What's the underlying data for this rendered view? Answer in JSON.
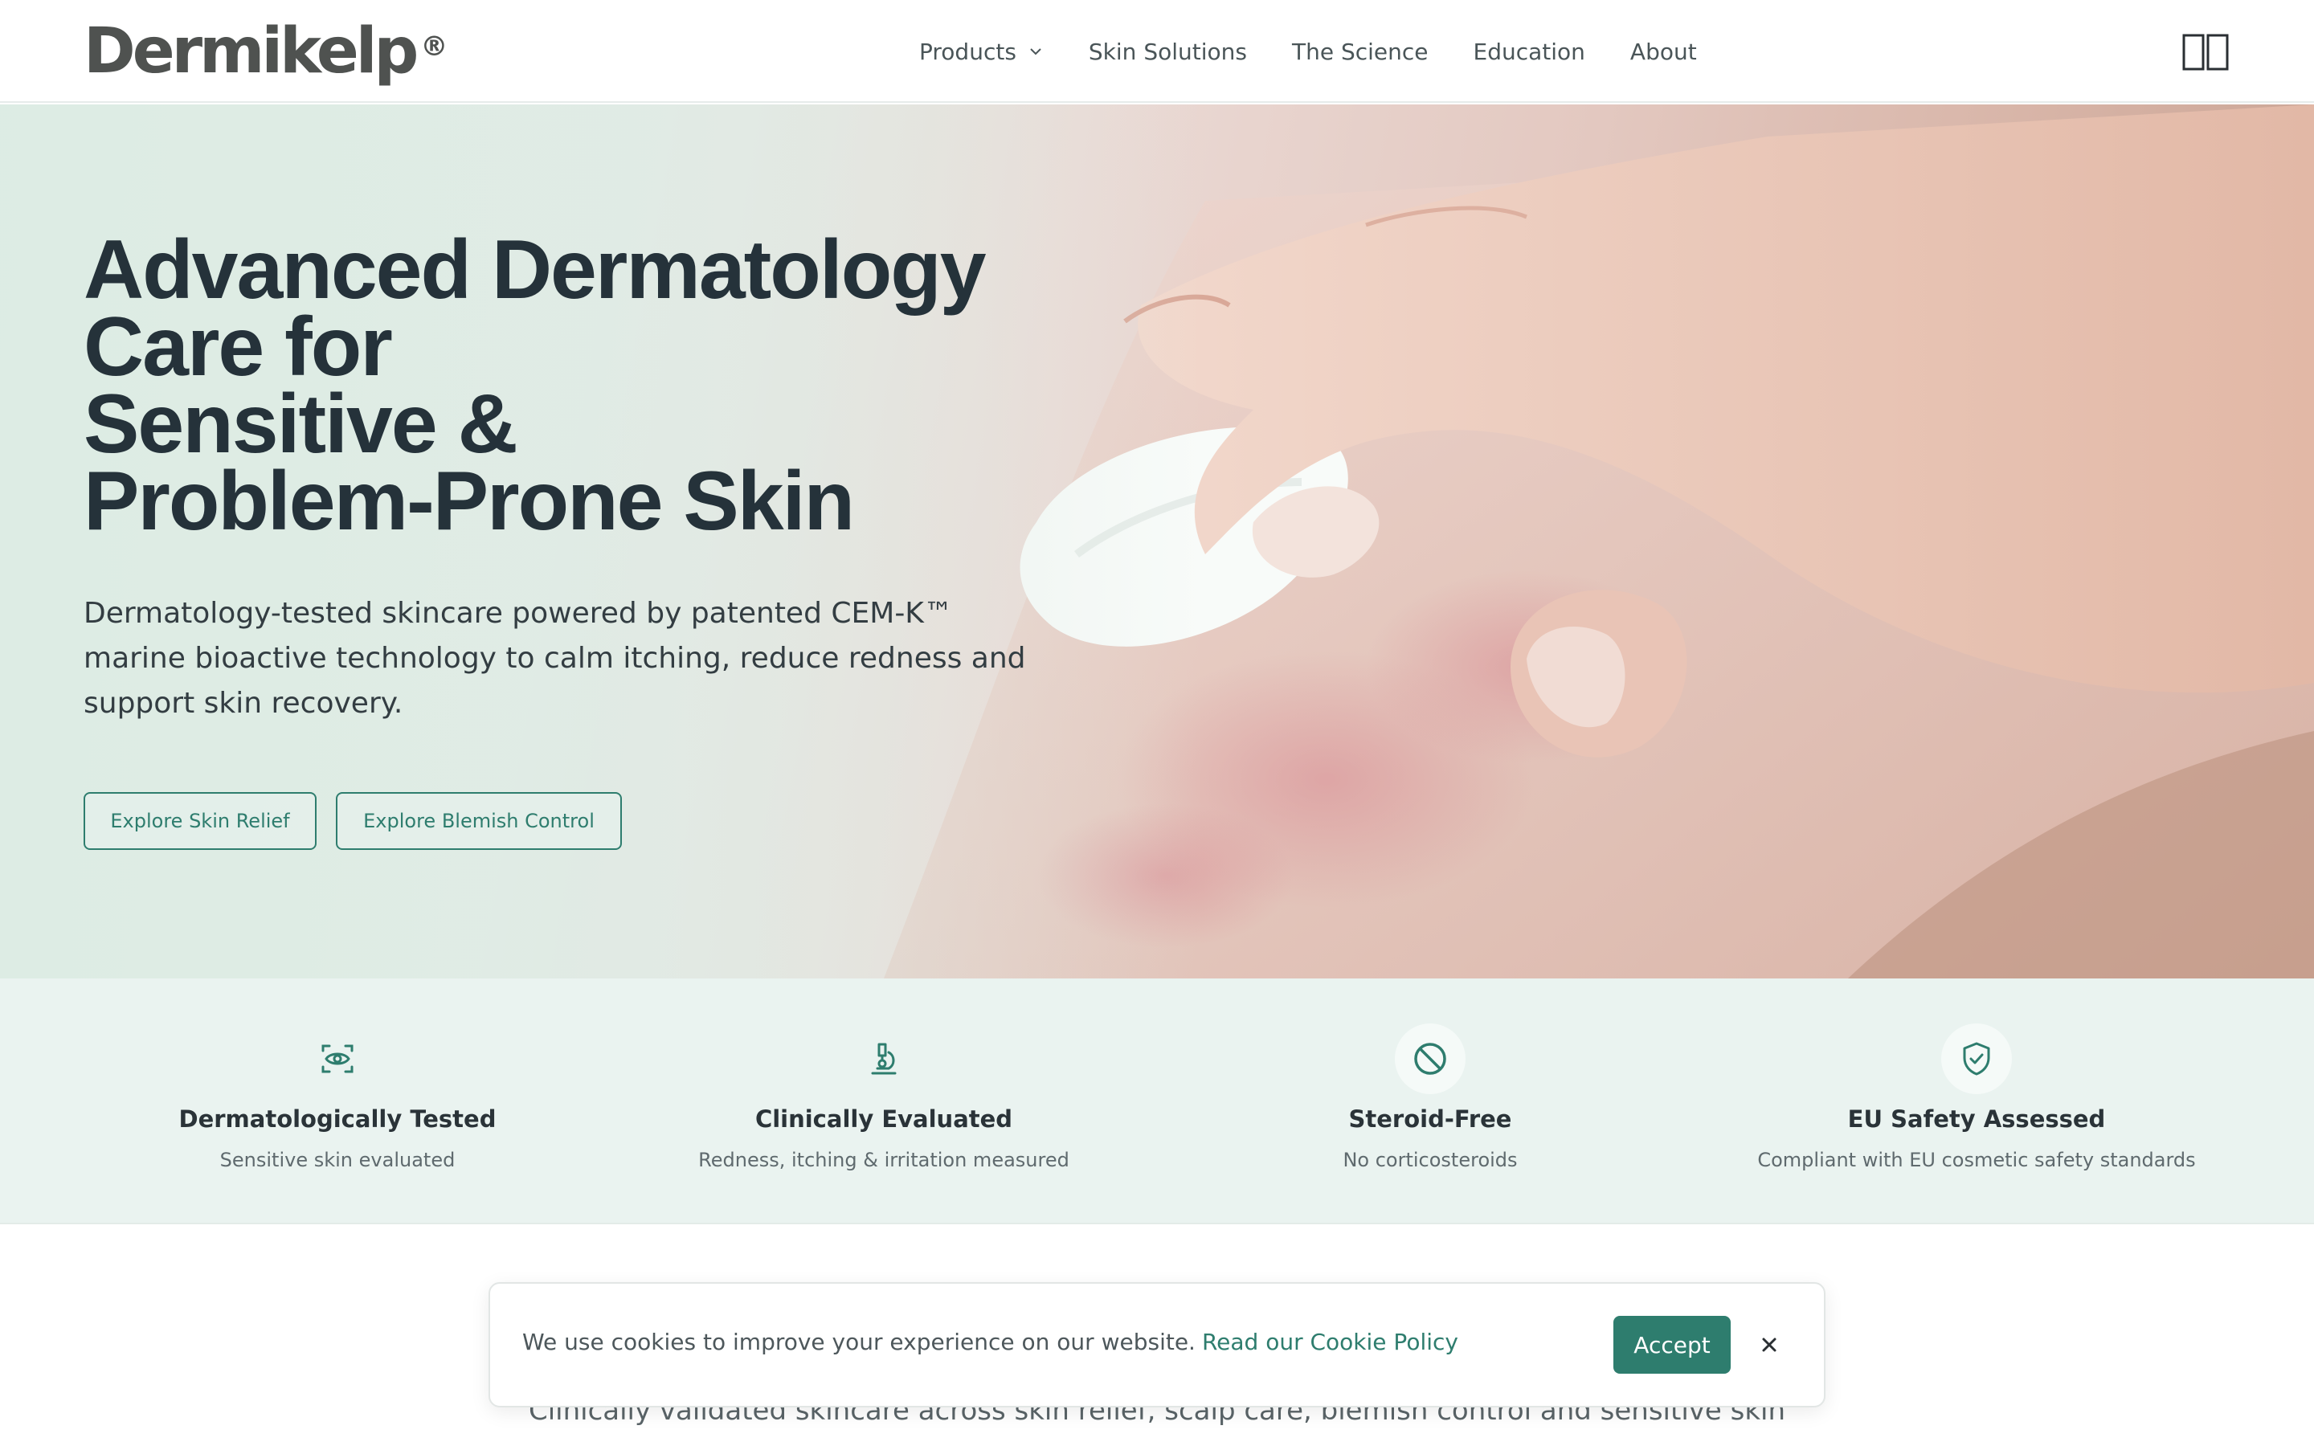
{
  "header": {
    "logo_text": "Dermikelp",
    "logo_mark": "®",
    "nav": [
      "Products",
      "Skin Solutions",
      "The Science",
      "Education",
      "About"
    ],
    "menu_icon": "menu-icon"
  },
  "hero": {
    "title_lines": [
      "Advanced Dermatology",
      "Care for",
      "Sensitive &",
      "Problem-Prone Skin"
    ],
    "subtitle": "Dermatology-tested skincare powered by patented CEM-K™ marine bioactive technology to calm itching, reduce redness and support skin recovery.",
    "buttons": [
      "Explore Skin Relief",
      "Explore Blemish Control"
    ]
  },
  "features": [
    {
      "icon": "eye-scan-icon",
      "title": "Dermatologically Tested",
      "desc": "Sensitive skin evaluated"
    },
    {
      "icon": "microscope-icon",
      "title": "Clinically Evaluated",
      "desc": "Redness, itching & irritation measured"
    },
    {
      "icon": "no-sign-icon",
      "title": "Steroid-Free",
      "desc": "No corticosteroids"
    },
    {
      "icon": "shield-check-icon",
      "title": "EU Safety Assessed",
      "desc": "Compliant with EU cosmetic safety standards"
    }
  ],
  "section": {
    "intro": "Clinically validated skincare across skin relief, scalp care, blemish control and sensitive skin"
  },
  "cookie": {
    "text": "We use cookies to improve your experience on our website.",
    "link": "Read our Cookie Policy",
    "accept": "Accept",
    "close_icon": "close-icon"
  },
  "colors": {
    "accent": "#2e7d6e",
    "heading": "#25323a",
    "feature_band": "#eaf3f0"
  }
}
